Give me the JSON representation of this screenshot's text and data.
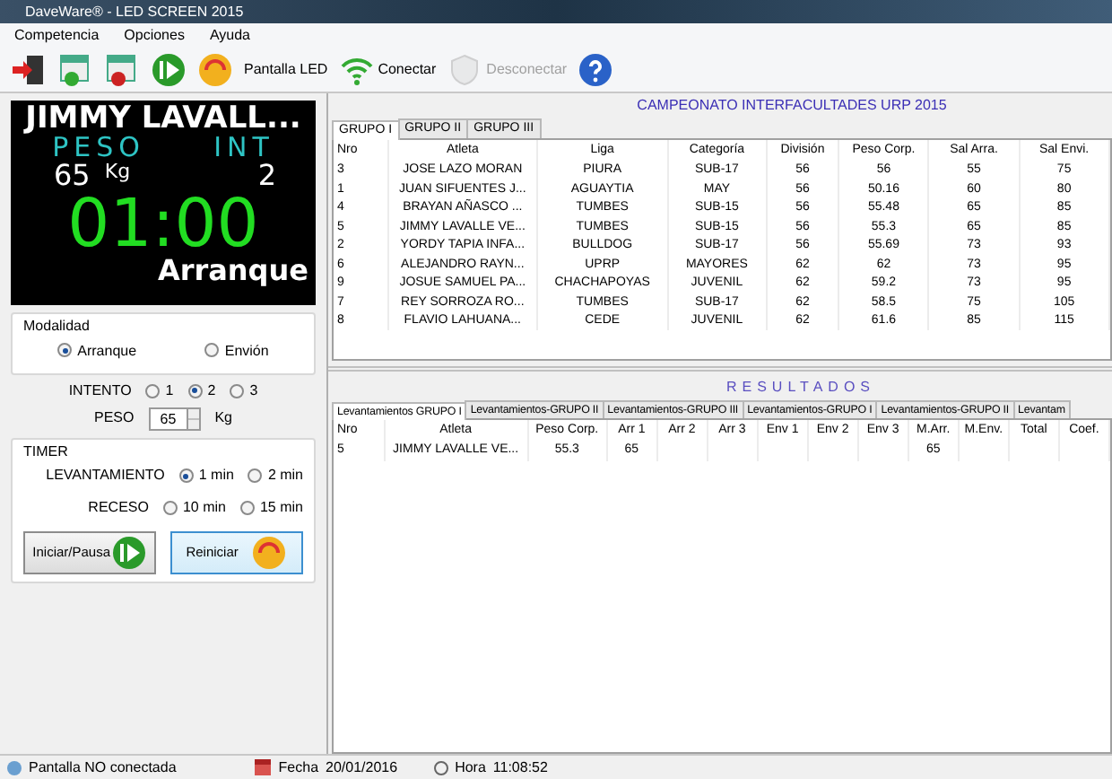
{
  "window": {
    "title": "DaveWare® - LED SCREEN 2015"
  },
  "menu": [
    "Competencia",
    "Opciones",
    "Ayuda"
  ],
  "toolbar": [
    {
      "kind": "icon",
      "disabled": false
    },
    {
      "kind": "icon",
      "disabled": false
    },
    {
      "kind": "icon",
      "disabled": false
    },
    {
      "kind": "icon",
      "disabled": false
    },
    {
      "kind": "icon",
      "disabled": false
    },
    {
      "kind": "text",
      "label": "Pantalla LED",
      "disabled": false
    },
    {
      "kind": "icontext",
      "label": "Conectar",
      "disabled": false
    },
    {
      "kind": "icontext",
      "label": "Desconectar",
      "disabled": true
    },
    {
      "kind": "icon",
      "disabled": false
    }
  ],
  "led": {
    "name": "JIMMY LAVALL...",
    "peso_label": "PESO",
    "int_label": "INT",
    "peso": "65",
    "unit": "Kg",
    "int": "2",
    "time": "01:00",
    "mode": "Arranque"
  },
  "modalidad": {
    "title": "Modalidad",
    "options": [
      {
        "label": "Arranque",
        "selected": true
      },
      {
        "label": "Envión",
        "selected": false
      }
    ]
  },
  "intento": {
    "label": "INTENTO",
    "options": [
      {
        "label": "1",
        "selected": false
      },
      {
        "label": "2",
        "selected": true
      },
      {
        "label": "3",
        "selected": false
      }
    ]
  },
  "peso": {
    "label": "PESO",
    "value": "65",
    "unit": "Kg"
  },
  "timer": {
    "title": "TIMER",
    "groups": [
      {
        "label": "LEVANTAMIENTO",
        "options": [
          {
            "label": "1 min",
            "selected": true
          },
          {
            "label": "2 min",
            "selected": false
          }
        ]
      },
      {
        "label": "RECESO",
        "options": [
          {
            "label": "10 min",
            "selected": false
          },
          {
            "label": "15 min",
            "selected": false
          }
        ]
      }
    ],
    "buttons": [
      {
        "label": "Iniciar/Pausa",
        "focused": false
      },
      {
        "label": "Reiniciar",
        "focused": true
      }
    ]
  },
  "championship": "CAMPEONATO INTERFACULTADES URP 2015",
  "group_tabs": [
    {
      "label": "GRUPO I",
      "selected": true
    },
    {
      "label": "GRUPO II",
      "selected": false
    },
    {
      "label": "GRUPO III",
      "selected": false
    }
  ],
  "athletes": {
    "columns": [
      "Nro",
      "Atleta",
      "Liga",
      "Categoría",
      "División",
      "Peso Corp.",
      "Sal Arra.",
      "Sal Envi."
    ],
    "rows": [
      [
        "3",
        "JOSE LAZO MORAN",
        "PIURA",
        "SUB-17",
        "56",
        "56",
        "55",
        "75"
      ],
      [
        "1",
        "JUAN SIFUENTES J...",
        "AGUAYTIA",
        "MAY",
        "56",
        "50.16",
        "60",
        "80"
      ],
      [
        "4",
        "BRAYAN AÑASCO ...",
        "TUMBES",
        "SUB-15",
        "56",
        "55.48",
        "65",
        "85"
      ],
      [
        "5",
        "JIMMY LAVALLE VE...",
        "TUMBES",
        "SUB-15",
        "56",
        "55.3",
        "65",
        "85"
      ],
      [
        "2",
        "YORDY TAPIA INFA...",
        "BULLDOG",
        "SUB-17",
        "56",
        "55.69",
        "73",
        "93"
      ],
      [
        "6",
        "ALEJANDRO RAYN...",
        "UPRP",
        "MAYORES",
        "62",
        "62",
        "73",
        "95"
      ],
      [
        "9",
        "JOSUE SAMUEL PA...",
        "CHACHAPOYAS",
        "JUVENIL",
        "62",
        "59.2",
        "73",
        "95"
      ],
      [
        "7",
        "REY SORROZA RO...",
        "TUMBES",
        "SUB-17",
        "62",
        "58.5",
        "75",
        "105"
      ],
      [
        "8",
        "FLAVIO LAHUANA...",
        "CEDE",
        "JUVENIL",
        "62",
        "61.6",
        "85",
        "115"
      ]
    ]
  },
  "results_title": "RESULTADOS",
  "result_tabs": [
    {
      "label": "Levantamientos GRUPO I",
      "selected": true
    },
    {
      "label": "Levantamientos-GRUPO II",
      "selected": false
    },
    {
      "label": "Levantamientos-GRUPO III",
      "selected": false
    },
    {
      "label": "Levantamientos-GRUPO I",
      "selected": false
    },
    {
      "label": "Levantamientos-GRUPO II",
      "selected": false
    },
    {
      "label": "Levantam",
      "selected": false
    }
  ],
  "results": {
    "columns": [
      "Nro",
      "Atleta",
      "Peso Corp.",
      "Arr 1",
      "Arr 2",
      "Arr 3",
      "Env 1",
      "Env 2",
      "Env 3",
      "M.Arr.",
      "M.Env.",
      "Total",
      "Coef."
    ],
    "rows": [
      [
        "5",
        "JIMMY LAVALLE VE...",
        "55.3",
        "65",
        null,
        null,
        null,
        null,
        null,
        "65",
        null,
        null,
        null
      ]
    ]
  },
  "status_bar": {
    "screen": "Pantalla NO conectada",
    "date_label": "Fecha",
    "date": "20/01/2016",
    "time_label": "Hora",
    "time": "11:08:52"
  }
}
